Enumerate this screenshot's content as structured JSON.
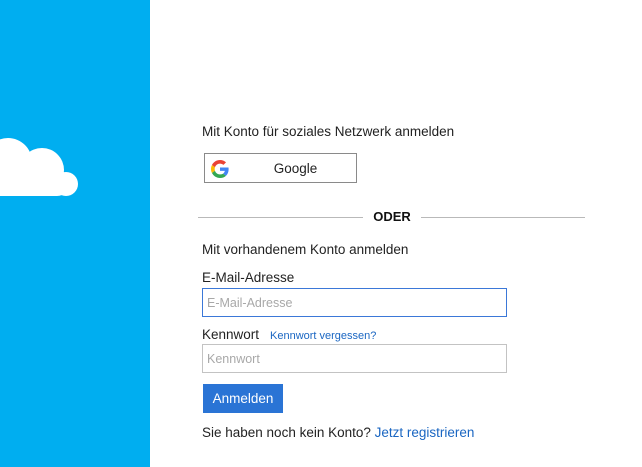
{
  "side_panel": {
    "background_color": "#00aef0",
    "logo_icon": "cloud-icon"
  },
  "social_login": {
    "title": "Mit Konto für soziales Netzwerk anmelden",
    "google_button": {
      "label": "Google",
      "icon": "google-g-icon"
    }
  },
  "divider": {
    "text": "ODER"
  },
  "account_login": {
    "title": "Mit vorhandenem Konto anmelden",
    "email_label": "E-Mail-Adresse",
    "email_placeholder": "E-Mail-Adresse",
    "email_value": "",
    "password_label": "Kennwort",
    "forgot_password_link": "Kennwort vergessen?",
    "password_placeholder": "Kennwort",
    "password_value": "",
    "signin_button": "Anmelden",
    "signin_button_color": "#2a74d5"
  },
  "register": {
    "prompt": "Sie haben noch kein Konto?",
    "link": "Jetzt registrieren"
  },
  "colors": {
    "link": "#1a66c2",
    "focused_border": "#3b78d8"
  }
}
